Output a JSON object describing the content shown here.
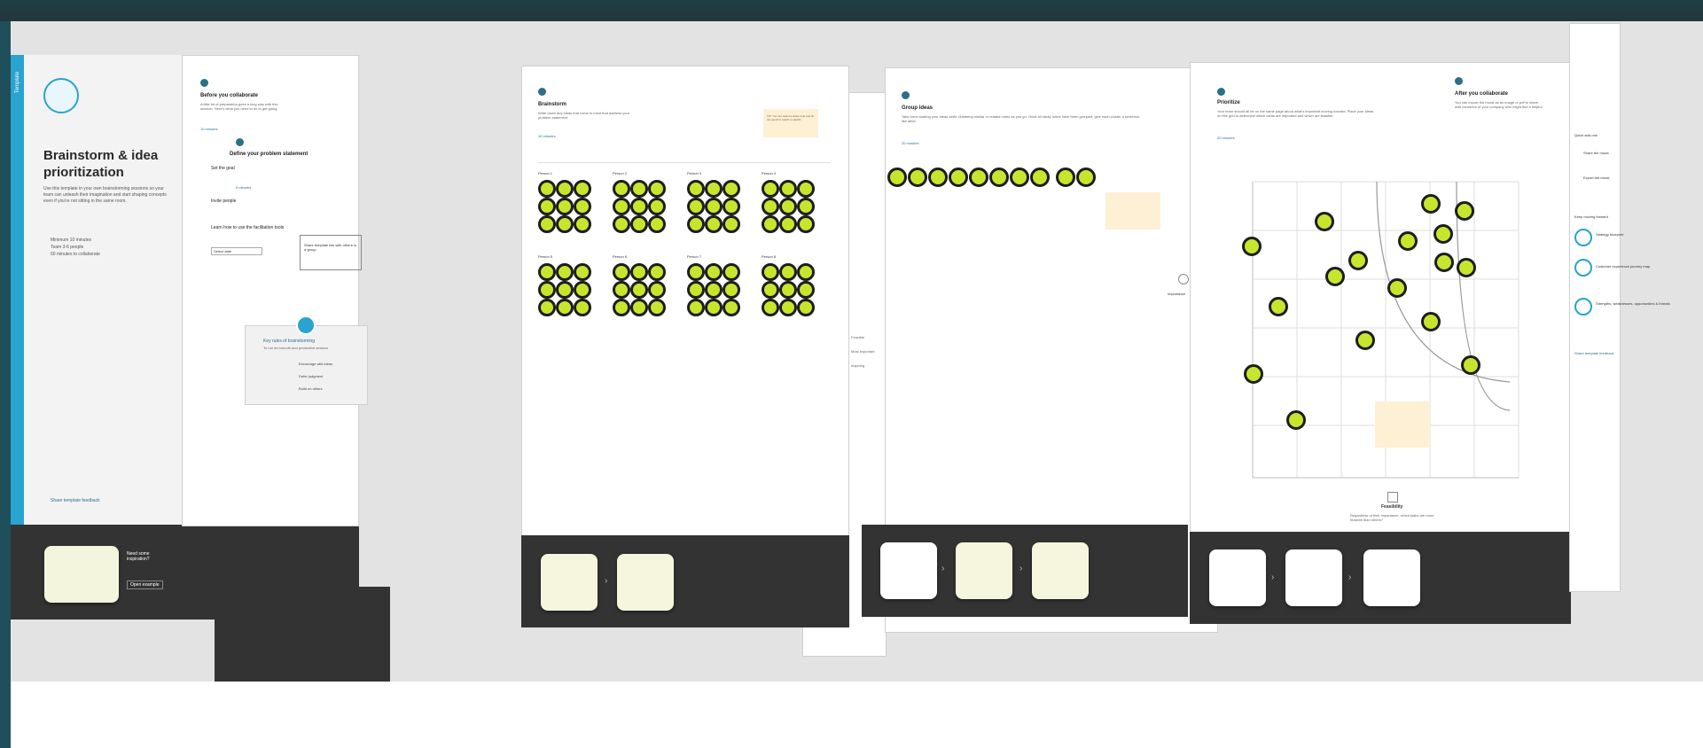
{
  "left_board": {
    "brand_label": "Template",
    "title": "Brainstorm & idea prioritization",
    "description": "Use this template in your own brainstorming sessions so your team can unleash their imagination and start shaping concepts even if you're not sitting in the same room.",
    "meta": [
      "Minimum 10 minutes",
      "Team 3-6 people",
      "60 minutes to collaborate"
    ],
    "footer_link": "Share template feedback",
    "dark_box_title": "Need some inspiration?",
    "dark_box_button": "Open example"
  },
  "prep_board": {
    "step1_title": "Before you collaborate",
    "step1_text": "A little bit of preparation goes a long way with this session. Here's what you need to do to get going.",
    "step1_time": "10 minutes",
    "step2_title": "Define your problem statement",
    "items": [
      "Set the goal",
      "Invite people",
      "Learn how to use the facilitation tools"
    ],
    "time_link": "5 minutes",
    "select_label": "Select date",
    "sketch_label": "Share template link with others in a group"
  },
  "popup": {
    "title": "Key rules of brainstorming",
    "subtitle": "To run an smooth and productive session",
    "rules": [
      "Encourage wild ideas",
      "Defer judgment",
      "Build on others"
    ]
  },
  "brainstorm": {
    "title": "Brainstorm",
    "desc": "Write down any ideas that come to mind that address your problem statement.",
    "time": "10 minutes",
    "note": "TIP: You can select a sticky note and hit the pencil to switch to sketch!",
    "groups": [
      "Person 1",
      "Person 2",
      "Person 3",
      "Person 4",
      "Person 5",
      "Person 6",
      "Person 7",
      "Person 8"
    ]
  },
  "groupideas": {
    "title": "Group ideas",
    "desc": "Take turns sharing your ideas while clustering similar or related notes as you go. Once all sticky notes have been grouped, give each cluster a sentence-like label.",
    "time": "20 minutes",
    "side_label": "Importance",
    "side_items": [
      "Feasible",
      "Most important",
      "Inspiring"
    ]
  },
  "prioritize": {
    "title": "Prioritize",
    "desc": "Your team should all be on the same page about what's important moving forward. Place your ideas on this grid to determine which ideas are important and which are feasible.",
    "time": "20 minutes",
    "axis_label": "Feasibility",
    "axis_caption": "Regardless of their importance, which tasks are more feasible than others?"
  },
  "after": {
    "title": "After you collaborate",
    "desc": "You can export the mural as an image or pdf to share with members of your company who might find it helpful.",
    "share_label": "Quick add-ons",
    "options": [
      "Share the mural",
      "Export the mural"
    ],
    "keep_label": "Keep moving forward",
    "links": [
      "Strategy blueprint",
      "Customer experience journey map",
      "Strengths, weaknesses, opportunities & threats"
    ],
    "footer_link": "Share template feedback"
  },
  "colors": {
    "sticky": "#c6e62d",
    "accent": "#2a9ec7",
    "dark": "#333333",
    "canvas": "#e3e3e3"
  }
}
